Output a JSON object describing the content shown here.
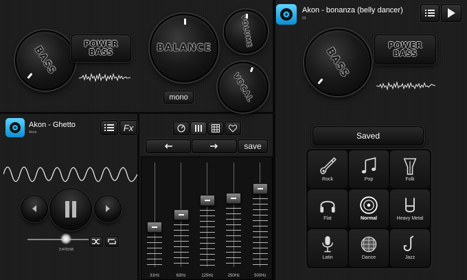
{
  "left_panel": {
    "bass_knob_label": "BASS",
    "power_bass_line1": "POWER",
    "power_bass_line2": "BASS",
    "balance_knob_label": "BALANCE",
    "volume_knob_label": "VOLUME",
    "vocal_knob_label": "VOCAL",
    "mono_button": "mono"
  },
  "left_player": {
    "track_title": "Akon - Ghetto",
    "track_artist": "Akon",
    "time": "2:47/3:58"
  },
  "right_player": {
    "track_title": "Akon - bonanza (belly dancer)",
    "track_sub": "03",
    "bass_knob_label": "BASS",
    "power_bass_line1": "POWER",
    "power_bass_line2": "BASS"
  },
  "equalizer": {
    "save_label": "save",
    "bands": [
      {
        "freq": "31Hz",
        "level": 0.38
      },
      {
        "freq": "63Hz",
        "level": 0.5
      },
      {
        "freq": "125Hz",
        "level": 0.64
      },
      {
        "freq": "250Hz",
        "level": 0.66
      },
      {
        "freq": "500Hz",
        "level": 0.75
      }
    ]
  },
  "presets": {
    "header": "Saved",
    "items": [
      {
        "label": "Rock",
        "icon": "guitar-icon"
      },
      {
        "label": "Pop",
        "icon": "music-notes-icon"
      },
      {
        "label": "Folk",
        "icon": "banjo-icon"
      },
      {
        "label": "Flat",
        "icon": "headphones-icon"
      },
      {
        "label": "Normal",
        "icon": "disc-icon",
        "active": true
      },
      {
        "label": "Heavy Metal",
        "icon": "rock-hand-icon"
      },
      {
        "label": "Latin",
        "icon": "microphone-icon"
      },
      {
        "label": "Dance",
        "icon": "disco-ball-icon"
      },
      {
        "label": "Jazz",
        "icon": "saxophone-icon"
      }
    ]
  },
  "colors": {
    "accent_blue": "#0a9fe0",
    "background": "#1e1e1e"
  }
}
